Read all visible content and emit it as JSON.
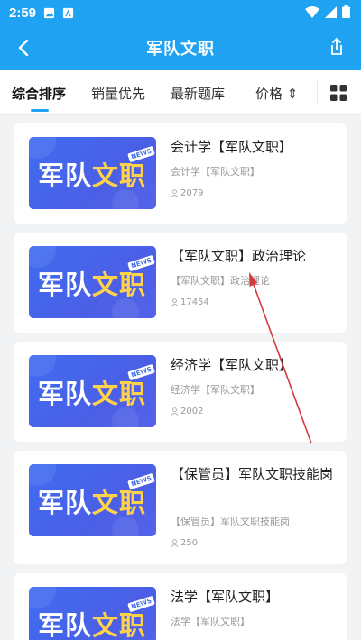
{
  "status_bar": {
    "time": "2:59"
  },
  "header": {
    "title": "军队文职"
  },
  "tabs": [
    {
      "label": "综合排序"
    },
    {
      "label": "销量优先"
    },
    {
      "label": "最新题库"
    },
    {
      "label": "价格 ⇕"
    }
  ],
  "thumbnail": {
    "text_white": "军队",
    "text_yellow": "文职",
    "badge": "NEWS"
  },
  "items": [
    {
      "title": "会计学【军队文职】",
      "subtitle": "会计学【军队文职】",
      "count": "2079"
    },
    {
      "title": "【军队文职】政治理论",
      "subtitle": "【军队文职】政治理论",
      "count": "17454"
    },
    {
      "title": "经济学【军队文职】",
      "subtitle": "经济学【军队文职】",
      "count": "2002"
    },
    {
      "title": "【保管员】军队文职技能岗",
      "subtitle": "【保管员】军队文职技能岗",
      "count": "250"
    },
    {
      "title": "法学【军队文职】",
      "subtitle": "法学【军队文职】",
      "count": ""
    }
  ],
  "colors": {
    "accent": "#1fa2f1",
    "thumb_yellow": "#ffd24a",
    "annotation": "#d33a3a"
  },
  "icons": {
    "back": "back-arrow-icon",
    "share": "share-icon",
    "grid": "grid-view-icon"
  }
}
